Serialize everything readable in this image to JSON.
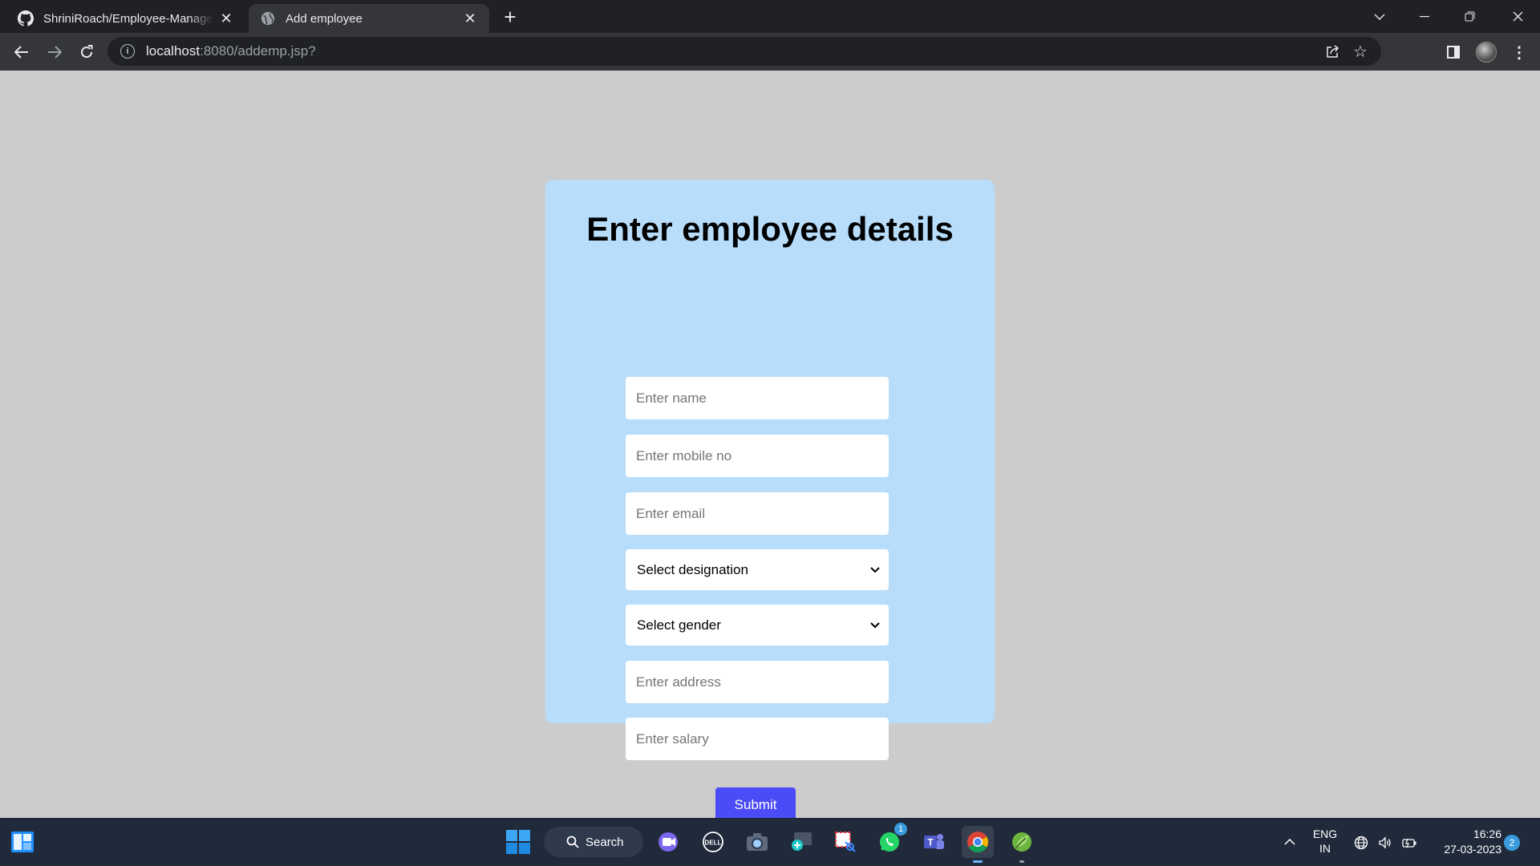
{
  "browser": {
    "tabs": [
      {
        "title": "ShriniRoach/Employee-Managem",
        "favicon": "github-icon",
        "active": false
      },
      {
        "title": "Add employee",
        "favicon": "globe-icon",
        "active": true
      }
    ],
    "url_host": "localhost",
    "url_rest": ":8080/addemp.jsp?"
  },
  "page": {
    "heading": "Enter employee details",
    "fields": {
      "name_placeholder": "Enter name",
      "mobile_placeholder": "Enter mobile no",
      "email_placeholder": "Enter email",
      "designation_selected": "Select designation",
      "gender_selected": "Select gender",
      "address_placeholder": "Enter address",
      "salary_placeholder": "Enter salary"
    },
    "submit_label": "Submit",
    "colors": {
      "card": "#b8ddfb",
      "submit": "#4b4bf7",
      "background": "#cccccc"
    }
  },
  "taskbar": {
    "search_label": "Search",
    "whatsapp_badge": "1",
    "lang_line1": "ENG",
    "lang_line2": "IN",
    "time": "16:26",
    "date": "27-03-2023",
    "notification_count": "2"
  }
}
